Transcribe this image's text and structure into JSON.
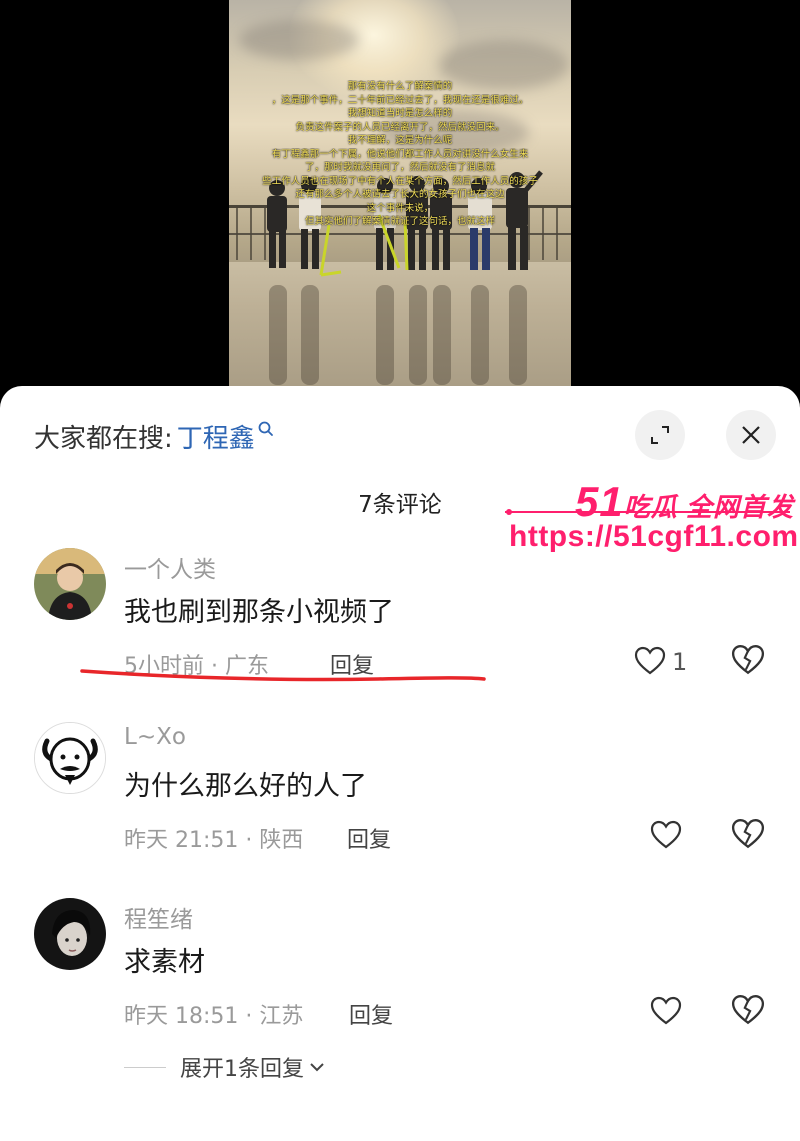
{
  "video": {
    "overlay_lines": [
      "那有没有什么了解案情的",
      "，这是那个事件，二十年前已经过去了，我现在还是很难过。",
      "我想知道当时是怎么样的",
      "负责这件案子的人员已经离开了，然后就没回来。",
      "我不理解，这是为什么呢",
      "有丁程鑫那一个下属，他说他们都工作人员对讲没什么女生来",
      "了，那时我就没再问了，然后就没有了消息就",
      "些工作人员也在现场了中有个人在某个方面，然后工作人员的孩子",
      "还有那么多个人被请去了长大的女孩子们也在这边",
      "这个事件未说，",
      "但其实他们了解案情就证了这句话，也就这样"
    ]
  },
  "sheet": {
    "search_prefix": "大家都在搜:",
    "search_term": "丁程鑫",
    "comment_count": "7条评论"
  },
  "watermark": {
    "brand_num": "51",
    "brand_text": "吃瓜 全网首发",
    "url": "https://51cgf11.com"
  },
  "comments": [
    {
      "user": "一个人类",
      "text": "我也刷到那条小视频了",
      "meta": "5小时前 · 广东",
      "reply": "回复",
      "likes": "1"
    },
    {
      "user": "L~Xo",
      "text": "为什么那么好的人了",
      "meta": "昨天 21:51 · 陕西",
      "reply": "回复",
      "likes": ""
    },
    {
      "user": "程笙绪",
      "text": "求素材",
      "meta": "昨天 18:51 · 江苏",
      "reply": "回复",
      "likes": ""
    }
  ],
  "expand_replies": "展开1条回复",
  "colors": {
    "accent_blue": "#2e66b4",
    "watermark_pink": "#ff1f6d",
    "annotation_red": "#e8262a"
  }
}
